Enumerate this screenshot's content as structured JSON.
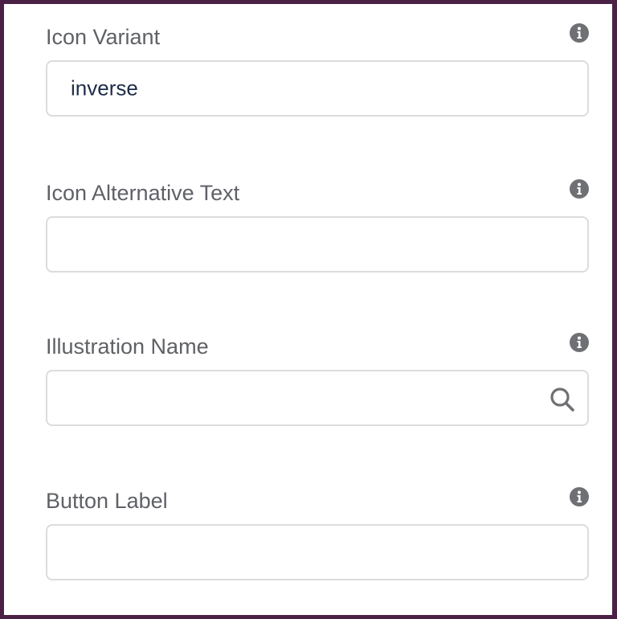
{
  "panel": {
    "fields": [
      {
        "label": "Icon Variant",
        "value": "inverse",
        "info_icon": "info-icon"
      },
      {
        "label": "Icon Alternative Text",
        "value": "",
        "info_icon": "info-icon"
      },
      {
        "label": "Illustration Name",
        "value": "",
        "info_icon": "info-icon",
        "trailing_icon": "search-icon"
      },
      {
        "label": "Button Label",
        "value": "",
        "info_icon": "info-icon"
      }
    ]
  },
  "colors": {
    "border": "#4a2145",
    "label": "#5f6166",
    "value_text": "#1f2d4a",
    "input_border": "#dcdcdc",
    "icon": "#6f7074"
  }
}
